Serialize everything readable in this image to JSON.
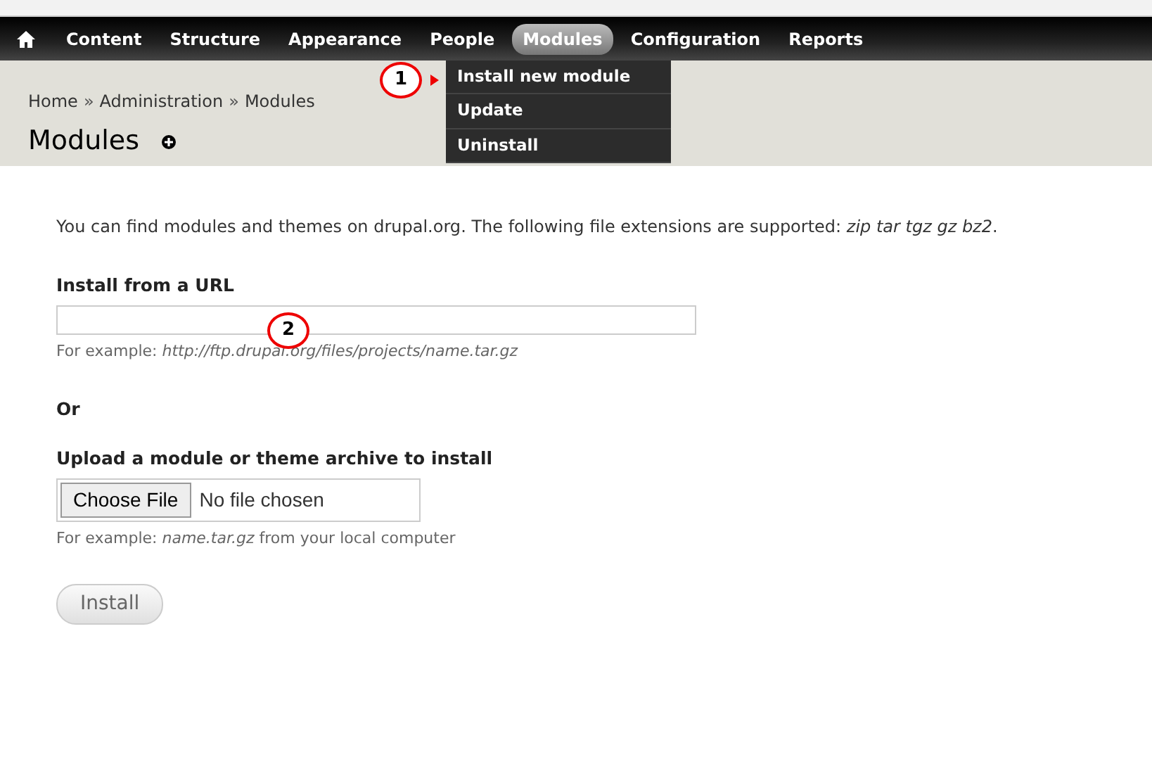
{
  "toolbar": {
    "items": [
      {
        "kind": "home",
        "selected": false
      },
      {
        "kind": "link",
        "label": "Content",
        "selected": false
      },
      {
        "kind": "link",
        "label": "Structure",
        "selected": false
      },
      {
        "kind": "link",
        "label": "Appearance",
        "selected": false
      },
      {
        "kind": "link",
        "label": "People",
        "selected": false
      },
      {
        "kind": "link",
        "label": "Modules",
        "selected": true
      },
      {
        "kind": "link",
        "label": "Configuration",
        "selected": false
      },
      {
        "kind": "link",
        "label": "Reports",
        "selected": false
      }
    ]
  },
  "dropdown": {
    "items": [
      "Install new module",
      "Update",
      "Uninstall"
    ]
  },
  "breadcrumb": {
    "items": [
      "Home",
      "Administration",
      "Modules"
    ],
    "separator": "»"
  },
  "page_title": "Modules",
  "intro": [
    {
      "kind": "text",
      "text": "You can find"
    },
    {
      "kind": "link",
      "text": "modules"
    },
    {
      "kind": "text",
      "text": "and"
    },
    {
      "kind": "link",
      "text": "themes"
    },
    {
      "kind": "text",
      "text": "on"
    },
    {
      "kind": "link",
      "text": "drupal.org"
    },
    {
      "kind": "text",
      "text": ". The following file extensions are supported:"
    },
    {
      "kind": "italic",
      "text": "zip tar tgz gz bz2"
    },
    {
      "kind": "text",
      "text": "."
    }
  ],
  "url_field": {
    "label": "Install from a URL",
    "description": "For example: *http://ftp.drupal.org/files/projects/name.tar.gz*"
  },
  "separator_text": "Or",
  "upload_field": {
    "label": "Upload a module or theme archive to install",
    "button": "Choose File",
    "status": "No file chosen",
    "description": "For example: *name.tar.gz* from your local computer"
  },
  "submit_button": "Install",
  "callouts": [
    {
      "number": "1"
    },
    {
      "number": "2"
    }
  ]
}
